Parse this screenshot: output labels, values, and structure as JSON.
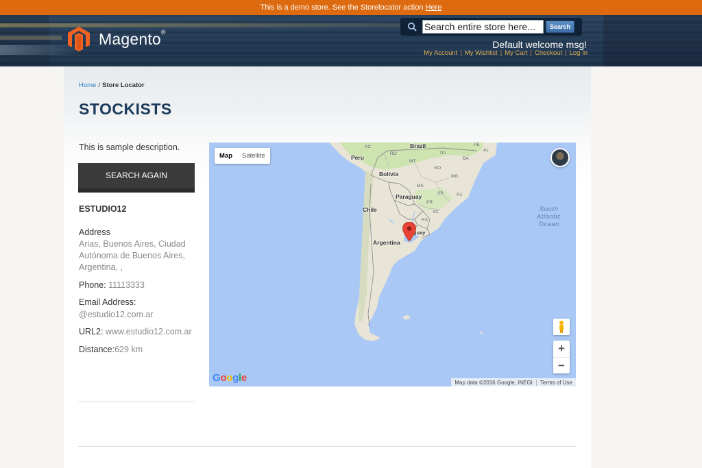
{
  "notice": {
    "text": "This is a demo store. See the Storelocator action ",
    "link": "Here"
  },
  "header": {
    "logo_text": "Magento",
    "logo_reg": "®",
    "search_placeholder": "Search entire store here...",
    "search_button": "Search",
    "welcome": "Default welcome msg!",
    "links": [
      "My Account",
      "My Wishlist",
      "My Cart",
      "Checkout",
      "Log In"
    ]
  },
  "breadcrumb": {
    "home": "Home",
    "separator": "/",
    "current": "Store Locator"
  },
  "page_title": "STOCKISTS",
  "description": "This is sample description.",
  "search_again": "SEARCH AGAIN",
  "store": {
    "name": "ESTUDIO12",
    "address_label": "Address",
    "address_value": "Arias, Buenos Aires, Ciudad Autónoma de Buenos Aires, Argentina, ,",
    "phone_label": "Phone:",
    "phone_value": "11113333",
    "email_label": "Email Address:",
    "email_value": "@estudio12.com.ar",
    "url_label": "URL2:",
    "url_value": "www.estudio12.com.ar",
    "distance_label": "Distance:",
    "distance_value": "629 km"
  },
  "map": {
    "type_map": "Map",
    "type_satellite": "Satellite",
    "zoom_in": "+",
    "zoom_out": "−",
    "countries": [
      "Brazil",
      "Peru",
      "Bolivia",
      "Paraguay",
      "Chile",
      "Argentina",
      "Uruguay"
    ],
    "states": [
      "AC",
      "RO",
      "MT",
      "TO",
      "BA",
      "GO",
      "MG",
      "MS",
      "SP",
      "PR",
      "SC",
      "RS",
      "RJ",
      "PE",
      "AL"
    ],
    "ocean_lines": [
      "South",
      "Atlantic",
      "Ocean"
    ],
    "google": "Google",
    "map_data": "Map data ©2016 Google, INEGI",
    "terms": "Terms of Use",
    "colors": {
      "water": "#a9c8f5",
      "land": "#e9e5d6",
      "forest": "#cde3b0",
      "marker": "#ea4335"
    }
  }
}
